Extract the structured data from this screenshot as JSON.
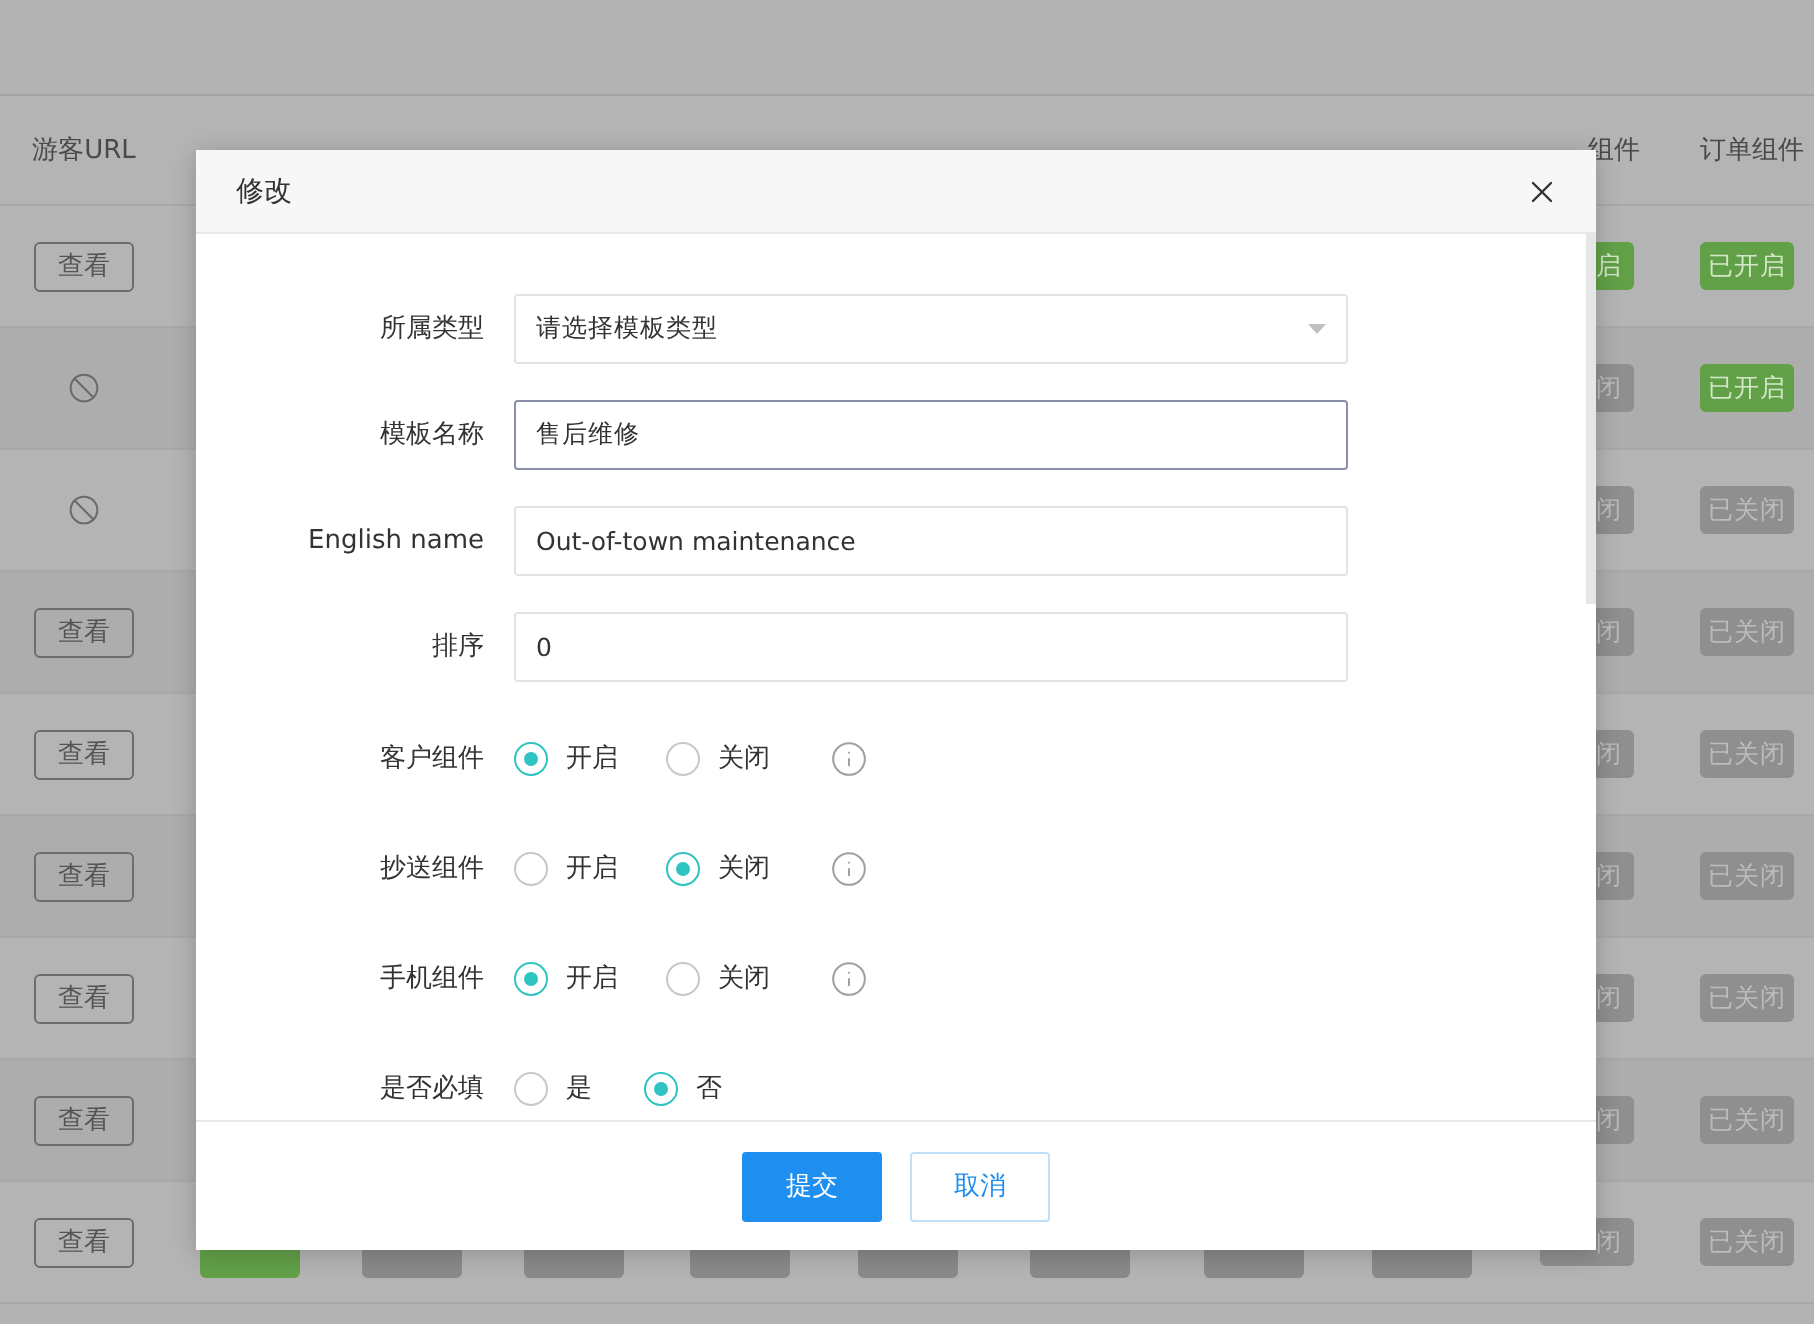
{
  "table": {
    "headers": {
      "visitor": "游客URL",
      "project": "组件",
      "order": "订单组件"
    },
    "rows": [
      {
        "visitor": {
          "kind": "button",
          "label": "查看"
        },
        "project": {
          "text": "启",
          "on": true
        },
        "order": {
          "text": "已开启",
          "on": true
        }
      },
      {
        "visitor": {
          "kind": "disabled"
        },
        "project": {
          "text": "闭",
          "on": false
        },
        "order": {
          "text": "已开启",
          "on": true
        }
      },
      {
        "visitor": {
          "kind": "disabled"
        },
        "project": {
          "text": "闭",
          "on": false
        },
        "order": {
          "text": "已关闭",
          "on": false
        }
      },
      {
        "visitor": {
          "kind": "button",
          "label": "查看"
        },
        "project": {
          "text": "闭",
          "on": false
        },
        "order": {
          "text": "已关闭",
          "on": false
        }
      },
      {
        "visitor": {
          "kind": "button",
          "label": "查看"
        },
        "project": {
          "text": "闭",
          "on": false
        },
        "order": {
          "text": "已关闭",
          "on": false
        }
      },
      {
        "visitor": {
          "kind": "button",
          "label": "查看"
        },
        "project": {
          "text": "闭",
          "on": false
        },
        "order": {
          "text": "已关闭",
          "on": false
        }
      },
      {
        "visitor": {
          "kind": "button",
          "label": "查看"
        },
        "project": {
          "text": "闭",
          "on": false
        },
        "order": {
          "text": "已关闭",
          "on": false
        }
      },
      {
        "visitor": {
          "kind": "button",
          "label": "查看"
        },
        "project": {
          "text": "闭",
          "on": false
        },
        "order": {
          "text": "已关闭",
          "on": false
        }
      },
      {
        "visitor": {
          "kind": "button",
          "label": "查看"
        },
        "project": {
          "text": "闭",
          "on": false
        },
        "order": {
          "text": "已关闭",
          "on": false
        },
        "covered_tags": [
          {
            "on": true
          },
          {
            "on": false
          },
          {
            "on": false
          },
          {
            "on": false
          },
          {
            "on": false
          },
          {
            "on": false
          },
          {
            "on": false
          },
          {
            "on": false
          }
        ]
      }
    ]
  },
  "dialog": {
    "title": "修改",
    "fields": [
      {
        "kind": "select",
        "label": "所属类型",
        "placeholder": "请选择模板类型"
      },
      {
        "kind": "text",
        "label": "模板名称",
        "value": "售后维修",
        "focused": true
      },
      {
        "kind": "text",
        "label": "English name",
        "value": "Out-of-town maintenance",
        "focused": false
      },
      {
        "kind": "text",
        "label": "排序",
        "value": "0",
        "focused": false
      },
      {
        "kind": "radio",
        "label": "客户组件",
        "info": true,
        "options": [
          {
            "label": "开启",
            "selected": true
          },
          {
            "label": "关闭",
            "selected": false
          }
        ]
      },
      {
        "kind": "radio",
        "label": "抄送组件",
        "info": true,
        "options": [
          {
            "label": "开启",
            "selected": false
          },
          {
            "label": "关闭",
            "selected": true
          }
        ]
      },
      {
        "kind": "radio",
        "label": "手机组件",
        "info": true,
        "options": [
          {
            "label": "开启",
            "selected": true
          },
          {
            "label": "关闭",
            "selected": false
          }
        ]
      },
      {
        "kind": "radio",
        "label": "是否必填",
        "info": false,
        "options": [
          {
            "label": "是",
            "selected": false
          },
          {
            "label": "否",
            "selected": true
          }
        ]
      }
    ],
    "buttons": [
      {
        "kind": "primary",
        "label": "提交"
      },
      {
        "kind": "default",
        "label": "取消"
      }
    ]
  }
}
